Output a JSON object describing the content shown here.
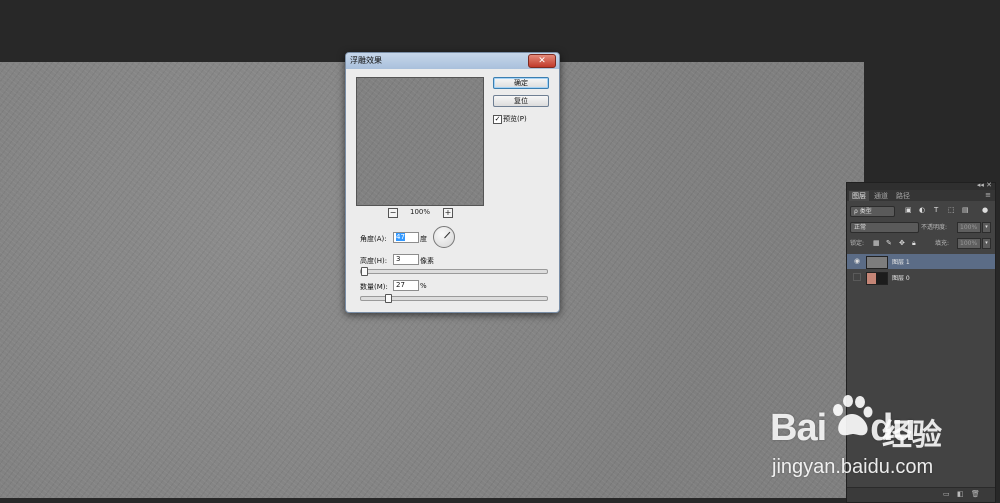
{
  "dialog": {
    "title": "浮雕效果",
    "close": "✕",
    "ok_label": "确定",
    "reset_label": "复位",
    "preview_checked": "✓",
    "preview_label": "预览(P)",
    "zoom_level": "100%",
    "zoom_out": "−",
    "zoom_in": "+",
    "angle_label": "角度(A):",
    "angle_value": "47",
    "angle_unit": "度",
    "height_label": "高度(H):",
    "height_value": "3",
    "height_unit": "像素",
    "amount_label": "数量(M):",
    "amount_value": "27",
    "amount_unit": "%"
  },
  "layers_panel": {
    "tabs": [
      "图层",
      "通道",
      "路径"
    ],
    "kind_filter": "ρ 类型",
    "blend_mode": "正常",
    "opacity_label": "不透明度:",
    "opacity_value": "100%",
    "lock_label": "锁定:",
    "fill_label": "填充:",
    "fill_value": "100%",
    "layers": [
      {
        "name": "图层 1",
        "selected": true
      },
      {
        "name": "图层 0",
        "selected": false
      }
    ]
  },
  "watermark": {
    "brand": "Bai",
    "brand2": "du",
    "cn": "经验",
    "url": "jingyan.baidu.com"
  },
  "colors": {
    "workspace": "#282828",
    "canvas": "#828282",
    "selected_layer": "#5b6c86",
    "dialog_bg": "#ececec"
  }
}
